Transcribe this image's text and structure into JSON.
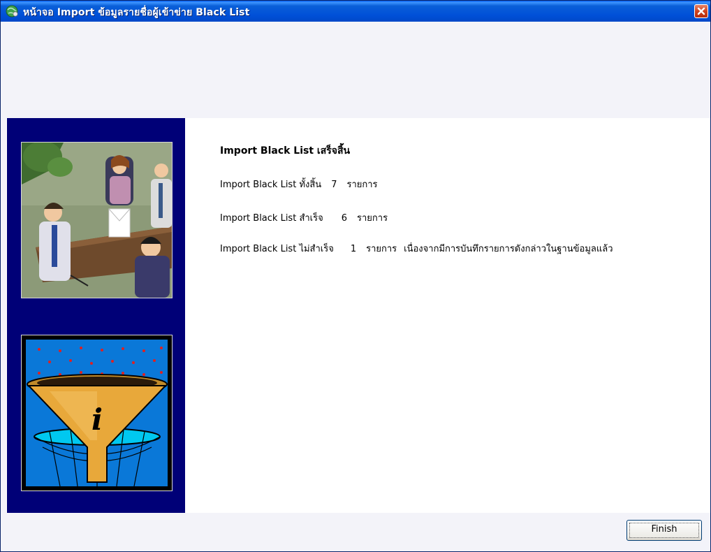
{
  "window": {
    "title": "หน้าจอ Import ข้อมูลรายชื่อผู้เข้าข่าย Black List",
    "close_icon": "close-icon"
  },
  "content": {
    "heading": "Import Black List เสร็จสิ้น",
    "total": {
      "label": "Import Black List ทั้งสิ้น",
      "count": "7",
      "unit": "รายการ"
    },
    "success": {
      "label": "Import Black List สำเร็จ",
      "count": "6",
      "unit": "รายการ"
    },
    "failed": {
      "label": "Import Black List ไม่สำเร็จ",
      "count": "1",
      "unit": "รายการ",
      "reason": "เนื่องจากมีการบันทึกรายการดังกล่าวในฐานข้อมูลแล้ว"
    }
  },
  "footer": {
    "finish_label": "Finish"
  }
}
